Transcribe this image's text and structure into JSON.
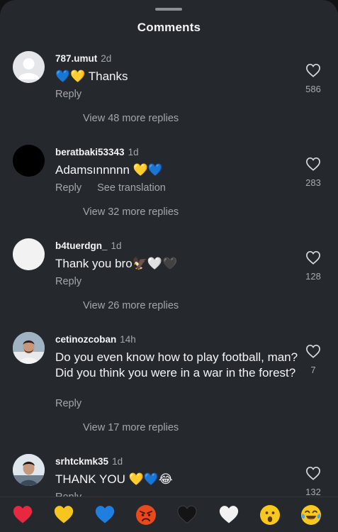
{
  "header": {
    "title": "Comments"
  },
  "comments": [
    {
      "username": "787.umut",
      "time": "2d",
      "text": "💙💛 Thanks",
      "reply_label": "Reply",
      "translate_label": "",
      "likes": "586",
      "view_replies": "View 48 more replies",
      "avatar": "default-avatar"
    },
    {
      "username": "beratbaki53343",
      "time": "1d",
      "text": "Adamsınnnnn 💛💙",
      "reply_label": "Reply",
      "translate_label": "See translation",
      "likes": "283",
      "view_replies": "View 32 more replies",
      "avatar": "black-avatar"
    },
    {
      "username": "b4tuerdgn_",
      "time": "1d",
      "text": "Thank you bro🦅🤍🖤",
      "reply_label": "Reply",
      "translate_label": "",
      "likes": "128",
      "view_replies": "View 26 more replies",
      "avatar": "white-avatar"
    },
    {
      "username": "cetinozcoban",
      "time": "14h",
      "text": "Do you even know how to play football, man? Did you think you were in a war in the forest?",
      "reply_label": "Reply",
      "translate_label": "",
      "likes": "7",
      "view_replies": "View 17 more replies",
      "avatar": "photo-avatar"
    },
    {
      "username": "srhtckmk35",
      "time": "1d",
      "text": "THANK YOU 💛💙😂",
      "reply_label": "Reply",
      "translate_label": "",
      "likes": "132",
      "view_replies": "",
      "avatar": "photo-avatar"
    }
  ],
  "reactions": [
    "❤️",
    "💛",
    "💙",
    "😡",
    "🖤",
    "🤍",
    "😮",
    "😂"
  ],
  "colors": {
    "background": "#25292e",
    "primary_text": "#f3f5f7",
    "secondary_text": "#a2a7ae",
    "heart_red": "#e8283e",
    "heart_yellow": "#f7c51e",
    "heart_blue": "#1f7fe0"
  }
}
